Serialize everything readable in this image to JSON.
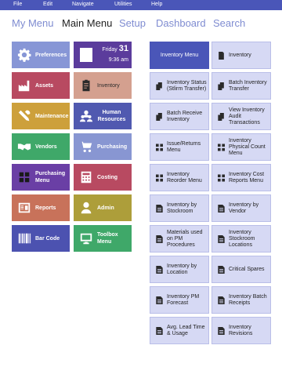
{
  "menubar": {
    "items": [
      "File",
      "Edit",
      "Navigate",
      "Utilities",
      "Help"
    ]
  },
  "nav": {
    "tabs": [
      {
        "label": "My Menu",
        "active": false
      },
      {
        "label": "Main Menu",
        "active": true
      },
      {
        "label": "Setup",
        "active": false
      },
      {
        "label": "Dashboard",
        "active": false
      },
      {
        "label": "Search",
        "active": false
      }
    ]
  },
  "colors": {
    "menubar": "#4a56b8",
    "tab_inactive": "#7f8cd1",
    "tab_active": "#222222",
    "submenu_button": "#d6d9f4",
    "submenu_active": "#4a56b8"
  },
  "clock": {
    "day": "Friday",
    "date": "31",
    "time": "9:36 am"
  },
  "tiles": [
    {
      "label": "Preferences",
      "icon": "gear-icon",
      "color": "#8796d6"
    },
    {
      "label": "Assets",
      "icon": "factory-icon",
      "color": "#b84a61"
    },
    {
      "label": "Inventory",
      "icon": "clipboard-icon",
      "color": "#d4a08f"
    },
    {
      "label": "Maintenance",
      "icon": "tools-icon",
      "color": "#cda03b"
    },
    {
      "label": "Human Resources",
      "icon": "people-icon",
      "color": "#5059b0"
    },
    {
      "label": "Vendors",
      "icon": "handshake-icon",
      "color": "#3fa869"
    },
    {
      "label": "Purchasing",
      "icon": "cart-icon",
      "color": "#8896d2"
    },
    {
      "label": "Purchasing Menu",
      "icon": "grid-icon",
      "color": "#6a3fa5"
    },
    {
      "label": "Costing",
      "icon": "calculator-icon",
      "color": "#b84a61"
    },
    {
      "label": "Reports",
      "icon": "report-icon",
      "color": "#c8725a"
    },
    {
      "label": "Admin",
      "icon": "admin-icon",
      "color": "#ad9e3a"
    },
    {
      "label": "Bar Code",
      "icon": "barcode-icon",
      "color": "#4c52b0"
    },
    {
      "label": "Toolbox Menu",
      "icon": "monitor-icon",
      "color": "#3fa869"
    }
  ],
  "submenu": [
    {
      "label": "Inventory Menu",
      "icon": "",
      "active": true
    },
    {
      "label": "Inventory",
      "icon": "document-icon",
      "active": false
    },
    {
      "label": "Inventory Status (Stlirm Transfer)",
      "icon": "documents-icon",
      "active": false
    },
    {
      "label": "Batch Inventory Transfer",
      "icon": "documents-icon",
      "active": false
    },
    {
      "label": "Batch Receive Inventory",
      "icon": "documents-icon",
      "active": false
    },
    {
      "label": "View Inventory Audit Transactions",
      "icon": "documents-icon",
      "active": false
    },
    {
      "label": "Issue/Returns Menu",
      "icon": "grid-icon",
      "active": false
    },
    {
      "label": "Inventory Physical Count Menu",
      "icon": "grid-icon",
      "active": false
    },
    {
      "label": "Inventory Reorder Menu",
      "icon": "grid-icon",
      "active": false
    },
    {
      "label": "Inventory Cost Reports Menu",
      "icon": "grid-icon",
      "active": false
    },
    {
      "label": "Inventory by Stockroom",
      "icon": "report-icon",
      "active": false
    },
    {
      "label": "Inventory by Vendor",
      "icon": "report-icon",
      "active": false
    },
    {
      "label": "Materials used on PM Procedures",
      "icon": "report-icon",
      "active": false
    },
    {
      "label": "Inventory Stockroom Locations",
      "icon": "report-icon",
      "active": false
    },
    {
      "label": "Inventory by Location",
      "icon": "report-icon",
      "active": false
    },
    {
      "label": "Critical Spares",
      "icon": "report-icon",
      "active": false
    },
    {
      "label": "Inventory PM Forecast",
      "icon": "report-icon",
      "active": false
    },
    {
      "label": "Inventory Batch Receipts",
      "icon": "report-icon",
      "active": false
    },
    {
      "label": "Avg. Lead Time & Usage",
      "icon": "report-icon",
      "active": false
    },
    {
      "label": "Inventory Revisions",
      "icon": "report-icon",
      "active": false
    }
  ]
}
